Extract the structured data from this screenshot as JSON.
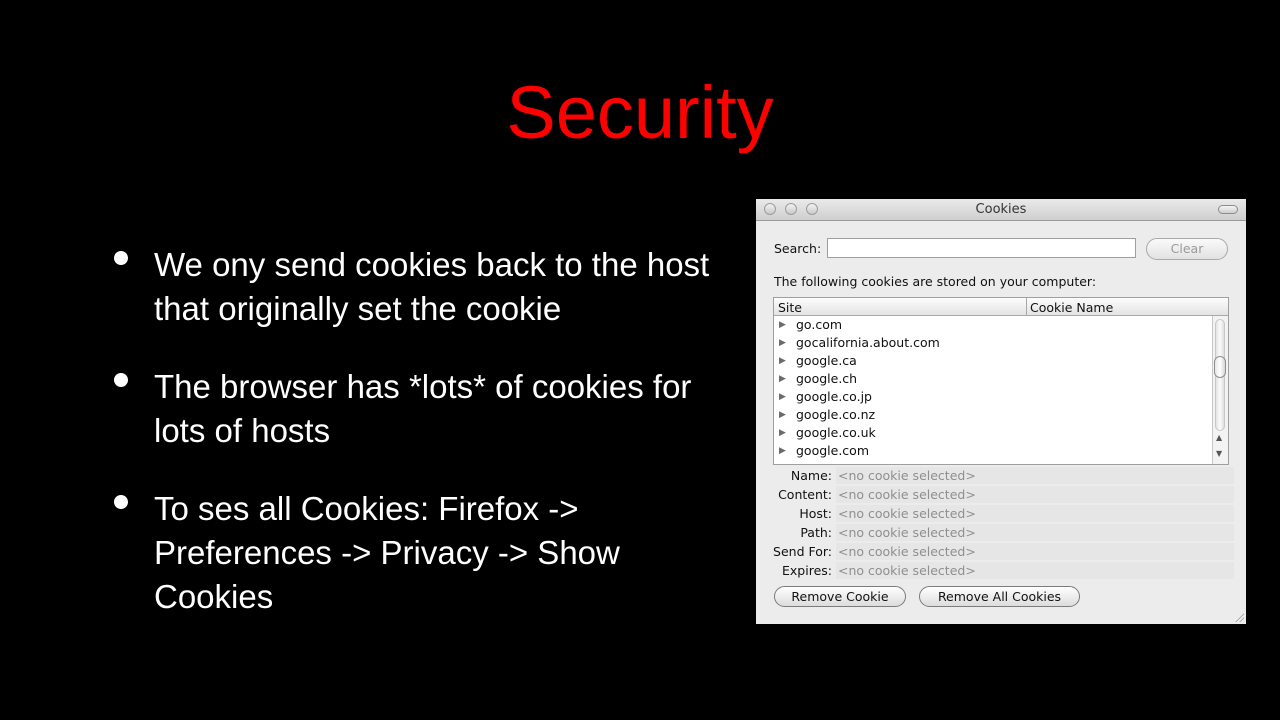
{
  "slide": {
    "title": "Security",
    "bullets": [
      "We ony send cookies back to the host that originally set the cookie",
      "The browser has *lots* of cookies for lots of hosts",
      "To ses all Cookies: Firefox -> Preferences -> Privacy -> Show Cookies"
    ],
    "title_color": "#ff0000"
  },
  "dialog": {
    "title": "Cookies",
    "search_label": "Search:",
    "search_value": "",
    "clear_label": "Clear",
    "info_text": "The following cookies are stored on your computer:",
    "columns": [
      "Site",
      "Cookie Name"
    ],
    "sites": [
      "go.com",
      "gocalifornia.about.com",
      "google.ca",
      "google.ch",
      "google.co.jp",
      "google.co.nz",
      "google.co.uk",
      "google.com"
    ],
    "fields": [
      {
        "label": "Name:",
        "value": "<no cookie selected>"
      },
      {
        "label": "Content:",
        "value": "<no cookie selected>"
      },
      {
        "label": "Host:",
        "value": "<no cookie selected>"
      },
      {
        "label": "Path:",
        "value": "<no cookie selected>"
      },
      {
        "label": "Send For:",
        "value": "<no cookie selected>"
      },
      {
        "label": "Expires:",
        "value": "<no cookie selected>"
      }
    ],
    "remove_cookie_label": "Remove Cookie",
    "remove_all_label": "Remove All Cookies"
  }
}
